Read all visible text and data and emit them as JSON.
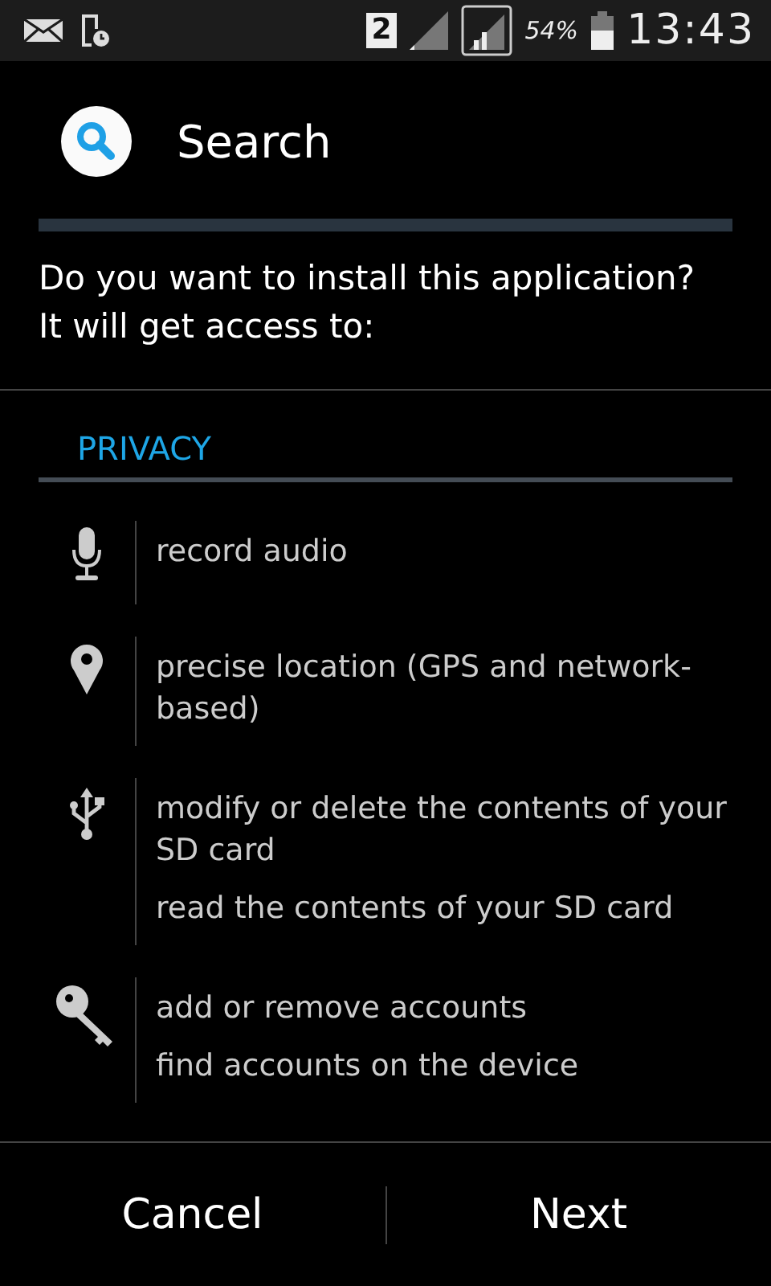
{
  "status_bar": {
    "sim_badge": "2",
    "battery_text": "54%",
    "time": "13:43"
  },
  "header": {
    "title": "Search"
  },
  "prompt": "Do you want to install this application? It will get access to:",
  "section": {
    "title": "PRIVACY"
  },
  "groups": [
    {
      "kind": "mic",
      "permissions": [
        "record audio"
      ]
    },
    {
      "kind": "pin",
      "permissions": [
        "precise location (GPS and network-based)"
      ]
    },
    {
      "kind": "usb",
      "permissions": [
        "modify or delete the contents of your SD card",
        "read the contents of your SD card"
      ]
    },
    {
      "kind": "key",
      "permissions": [
        "add or remove accounts",
        "find accounts on the device"
      ]
    }
  ],
  "buttons": [
    "Cancel",
    "Next"
  ]
}
